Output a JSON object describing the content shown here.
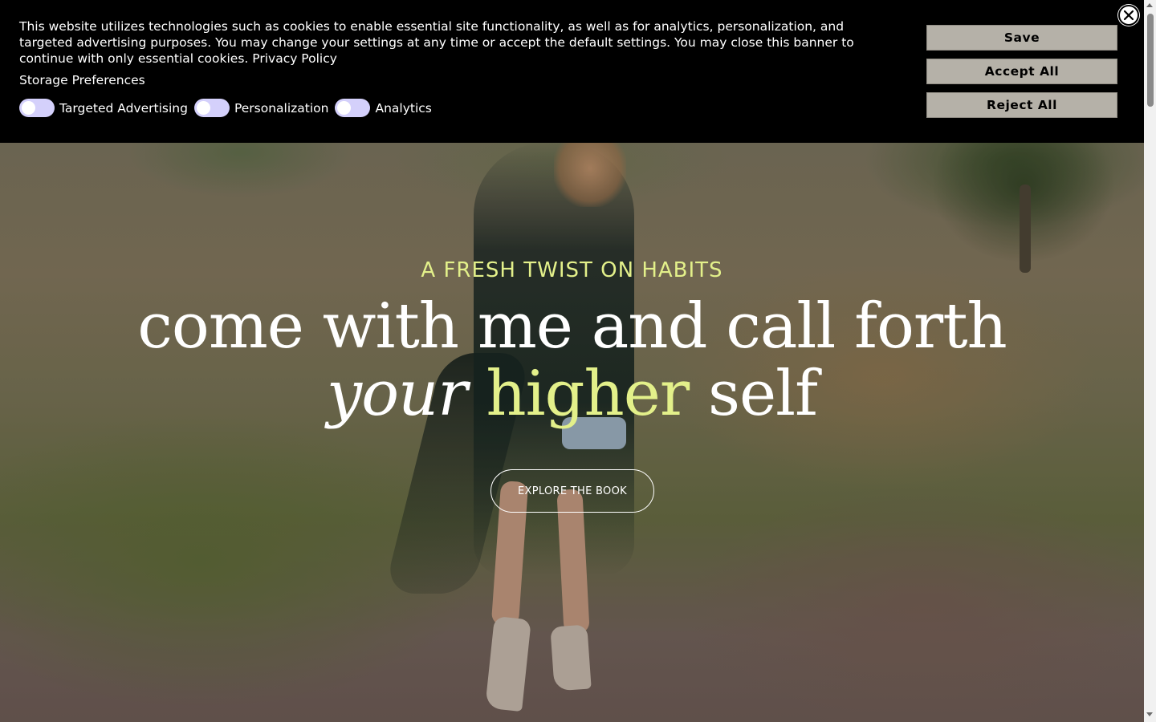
{
  "banner": {
    "message": "This website utilizes technologies such as cookies to enable essential site functionality, as well as for analytics, personalization, and targeted advertising purposes. You may change your settings at any time or accept the default settings. You may close this banner to continue with only essential cookies.",
    "privacy_link": "Privacy Policy",
    "storage_title": "Storage Preferences",
    "toggles": [
      {
        "label": "Targeted Advertising",
        "on": false
      },
      {
        "label": "Personalization",
        "on": false
      },
      {
        "label": "Analytics",
        "on": false
      }
    ],
    "buttons": {
      "save": "Save",
      "accept_all": "Accept All",
      "reject_all": "Reject All"
    },
    "close_icon": "close-icon"
  },
  "hero": {
    "eyebrow": "A FRESH TWIST ON HABITS",
    "headline_line1": "come with me and call forth",
    "headline_your": "your",
    "headline_higher": "higher",
    "headline_self": "self",
    "cta_label": "EXPLORE THE BOOK",
    "accent_color": "#e3f08a"
  },
  "colors": {
    "banner_bg": "#000000",
    "button_bg": "#b5b1a8",
    "toggle_track": "#d4d0fb"
  }
}
